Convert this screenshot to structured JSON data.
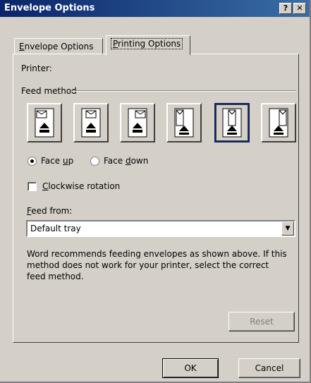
{
  "window": {
    "title": "Envelope Options",
    "help_label": "?",
    "close_label": "✕"
  },
  "tabs": [
    {
      "label": "Envelope Options",
      "accel": "E",
      "rest": "nvelope Options"
    },
    {
      "label": "Printing Options",
      "accel": "P",
      "rest": "rinting Options",
      "active": true
    }
  ],
  "printer": {
    "label": "Printer:"
  },
  "feed_method": {
    "label": "Feed method",
    "options": [
      {
        "name": "horizontal-left",
        "selected": false
      },
      {
        "name": "horizontal-center",
        "selected": false
      },
      {
        "name": "horizontal-right",
        "selected": false
      },
      {
        "name": "vertical-left",
        "selected": false
      },
      {
        "name": "vertical-center",
        "selected": true
      },
      {
        "name": "vertical-right",
        "selected": false
      }
    ]
  },
  "orientation": {
    "face_up": {
      "pre": "Face ",
      "accel": "u",
      "post": "p",
      "checked": true
    },
    "face_down": {
      "pre": "Face ",
      "accel": "d",
      "post": "own",
      "checked": false
    }
  },
  "clockwise": {
    "accel": "C",
    "rest": "lockwise rotation",
    "checked": false
  },
  "feed_from": {
    "accel": "F",
    "rest": "eed from:",
    "value": "Default tray"
  },
  "note": "Word recommends feeding envelopes as shown above. If this method does not work for your printer, select the correct feed method.",
  "buttons": {
    "reset": "Reset",
    "ok": "OK",
    "cancel": "Cancel"
  }
}
